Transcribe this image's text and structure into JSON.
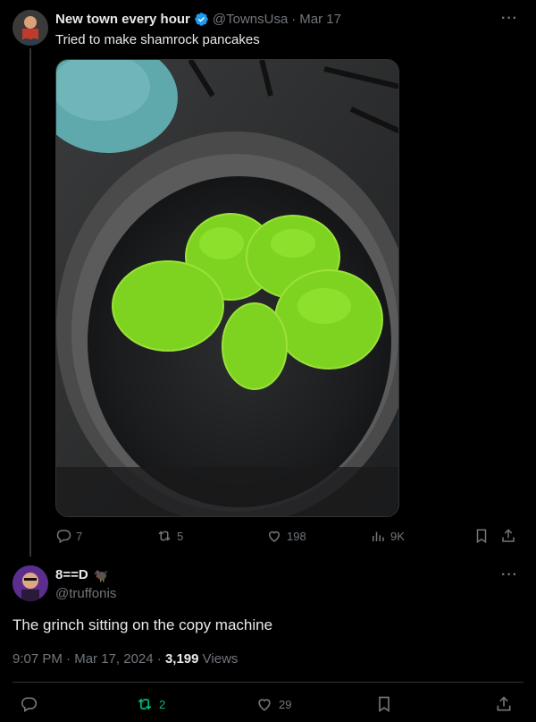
{
  "tweet": {
    "author_name": "New town every hour",
    "handle": "@TownsUsa",
    "date": "Mar 17",
    "text": "Tried to make shamrock pancakes",
    "actions": {
      "replies": "7",
      "reposts": "5",
      "likes": "198",
      "views": "9K"
    }
  },
  "reply": {
    "author_name": "8==D",
    "handle": "@truffonis",
    "text": "The grinch sitting on the copy machine",
    "time": "9:07 PM",
    "date": "Mar 17, 2024",
    "views_count": "3,199",
    "views_label": "Views",
    "actions": {
      "reposts": "2",
      "likes": "29"
    }
  },
  "colors": {
    "background": "#000000",
    "muted": "#71767b",
    "verified": "#1d9bf0",
    "repost_active": "#00ba7c"
  },
  "icons": [
    "verified-badge-icon",
    "more-icon",
    "reply-icon",
    "repost-icon",
    "like-icon",
    "views-icon",
    "bookmark-icon",
    "share-icon",
    "turkey-emoji-icon"
  ]
}
